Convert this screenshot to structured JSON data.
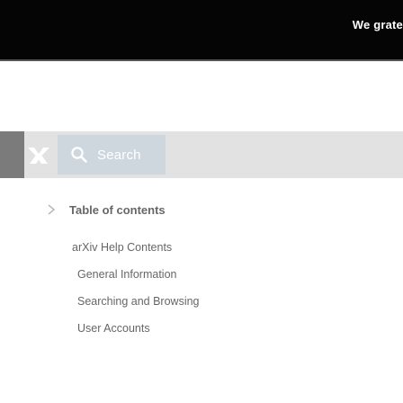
{
  "banner": {
    "text": "We grate"
  },
  "nav": {
    "search_label": "Search"
  },
  "toc": {
    "title": "Table of contents",
    "items": [
      {
        "label": "arXiv Help Contents",
        "level": 1
      },
      {
        "label": "General Information",
        "level": 2
      },
      {
        "label": "Searching and Browsing",
        "level": 2
      },
      {
        "label": "User Accounts",
        "level": 2
      }
    ]
  },
  "icons": {
    "logo": "arxiv-logo-icon",
    "search": "search-icon",
    "toc_toggle": "chevron-right-icon"
  },
  "colors": {
    "banner_bg": "#050505",
    "nav_bg": "#d4d4d4",
    "nav_dark": "#3d3d3d",
    "search_bg": "#b9c5cf",
    "text": "#1c1c1c"
  }
}
